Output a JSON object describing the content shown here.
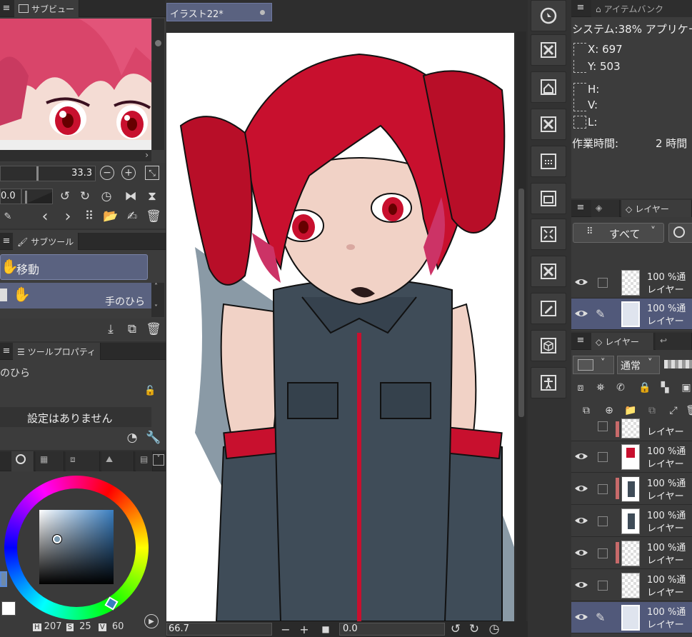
{
  "subview": {
    "tab": "サブビュー"
  },
  "navigator": {
    "zoom": "33.3",
    "rotate": "0.0"
  },
  "subtool": {
    "tab": "サブツール",
    "group": "移動",
    "item": "手のひら"
  },
  "toolprop": {
    "tab": "ツールプロパティ",
    "tool_name": "のひら",
    "no_settings": "設定はありません"
  },
  "color": {
    "h_label": "H",
    "h": "207",
    "s_label": "S",
    "s": "25",
    "v_label": "V",
    "v": "60",
    "accent": "#3a7ec0"
  },
  "canvas": {
    "tab": "イラスト22*",
    "zoom": "66.7",
    "rotation": "0.0"
  },
  "item_bank": {
    "tab": "アイテムバンク"
  },
  "info": {
    "system_line": "システム:38% アプリケー",
    "x": "X: 697",
    "y": "Y: 503",
    "h": "H:",
    "v": "V:",
    "l": "L:",
    "work_time_label": "作業時間:",
    "work_time_value": "2 時間"
  },
  "layer_search": {
    "tab": "レイヤー",
    "filter": "すべて"
  },
  "search_layers": [
    {
      "opacity": "100 %通",
      "name": "レイヤー"
    },
    {
      "opacity": "100 %通",
      "name": "レイヤー"
    }
  ],
  "layer_panel": {
    "tab": "レイヤー",
    "blend": "通常"
  },
  "layers": [
    {
      "opacity": "",
      "name": "レイヤー"
    },
    {
      "opacity": "100 %通",
      "name": "レイヤー"
    },
    {
      "opacity": "100 %通",
      "name": "レイヤー"
    },
    {
      "opacity": "100 %通",
      "name": "レイヤー"
    },
    {
      "opacity": "100 %通",
      "name": "レイヤー"
    },
    {
      "opacity": "100 %通",
      "name": "レイヤー"
    },
    {
      "opacity": "100 %通",
      "name": "レイヤー"
    }
  ]
}
